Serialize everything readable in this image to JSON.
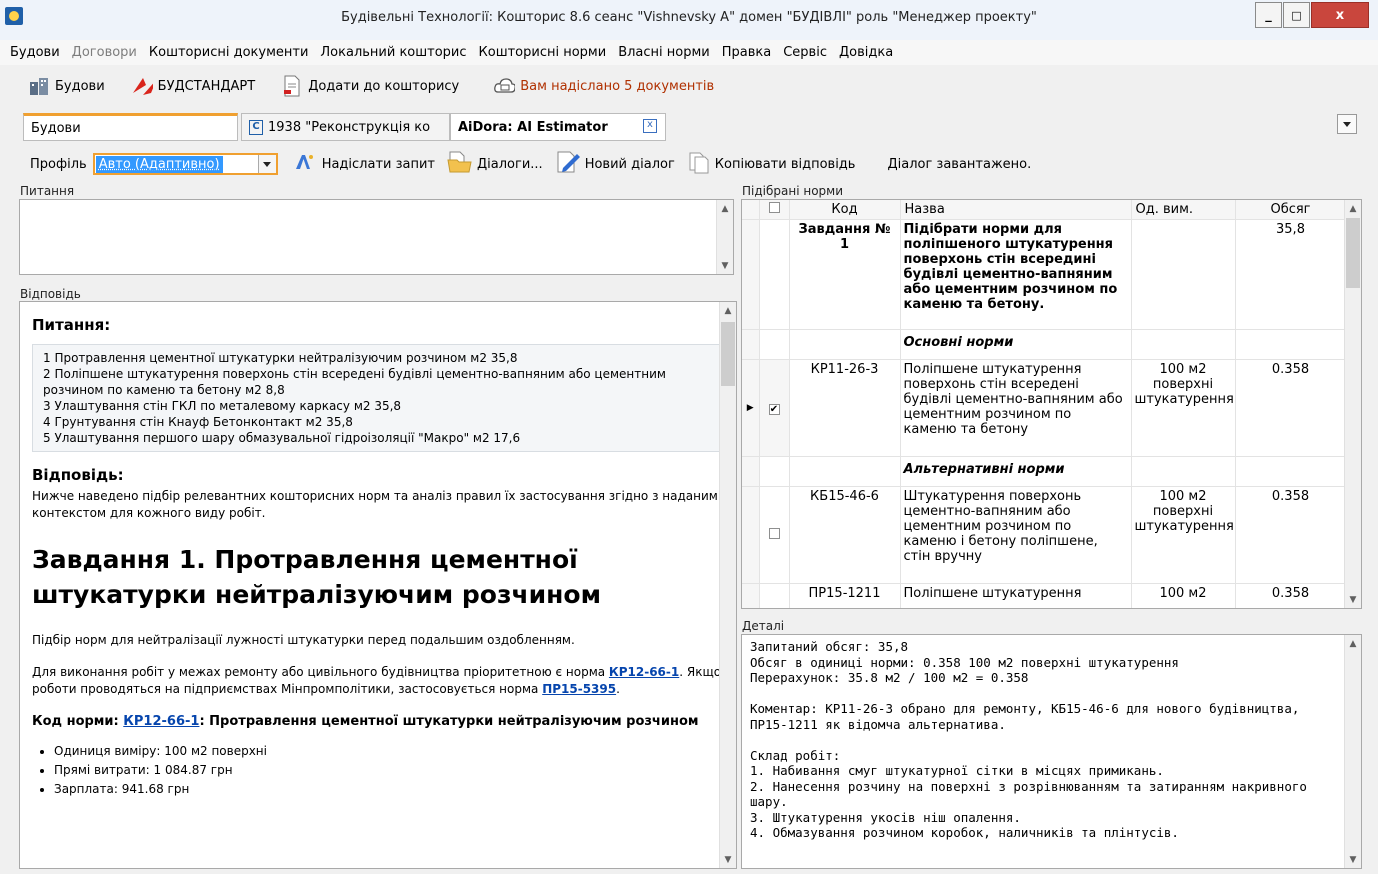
{
  "window": {
    "title": "Будівельні Технології: Кошторис 8.6     сеанс \"Vishnevsky A\"  домен \"БУДІВЛІ\" роль \"Менеджер проекту\"",
    "minimize": "_",
    "maximize": "□",
    "close": "x"
  },
  "menu": [
    "Будови",
    "Договори",
    "Кошторисні документи",
    "Локальний кошторис",
    "Кошторисні норми",
    "Власні норми",
    "Правка",
    "Сервіс",
    "Довідка"
  ],
  "toolbar": {
    "buildings": "Будови",
    "budstandart": "БУДСТАНДАРТ",
    "add_to_estimate": "Додати до кошторису",
    "sent_docs": "Вам надіслано 5 документів"
  },
  "tabs": {
    "t1": "Будови",
    "t2": "1938 \"Реконструкція ко",
    "t2_icon": "C",
    "t3": "AiDora: AI Estimator",
    "close": "x"
  },
  "profile": {
    "label": "Профіль",
    "value": "Авто (Адаптивно)",
    "send": "Надіслати запит",
    "dialogs": "Діалоги...",
    "new_dialog": "Новий діалог",
    "copy": "Копіювати відповідь",
    "status": "Діалог завантажено."
  },
  "question_label": "Питання",
  "answer_label": "Відповідь",
  "answer": {
    "q_heading": "Питання:",
    "questions": [
      "1 Протравлення цементної штукатурки нейтралізуючим розчином м2 35,8",
      "2 Поліпшене штукатурення поверхонь стін всередені будівлі цементно-вапняним або цементним розчином по каменю та бетону м2 8,8",
      "3 Улаштування стін ГКЛ по металевому каркасу м2 35,8",
      "4 Грунтування стін Кнауф Бетонконтакт м2 35,8",
      "5 Улаштування першого шару обмазувальної гідроізоляції \"Макро\" м2 17,6"
    ],
    "a_heading": "Відповідь:",
    "intro": "Нижче наведено підбір релевантних кошторисних норм та аналіз правил їх застосування згідно з наданим контекстом для кожного виду робіт.",
    "task_title": "Завдання 1. Протравлення цементної штукатурки нейтралізуючим розчином",
    "p1": "Підбір норм для нейтралізації лужності штукатурки перед подальшим оздобленням.",
    "p2a": "Для виконання робіт у межах ремонту або цивільного будівництва пріоритетною є норма ",
    "p2_link1": "КР12-66-1",
    "p2b": ". Якщо роботи проводяться на підприємствах Мінпромполітики, застосовується норма ",
    "p2_link2": "ПР15-5395",
    "p2c": ".",
    "code_label": "Код норми: ",
    "code_link": "КР12-66-1",
    "code_rest": ": Протравлення цементної штукатурки нейтралізуючим розчином",
    "bullets": [
      "Одиниця виміру: 100 м2 поверхні",
      "Прямі витрати: 1 084.87 грн",
      "Зарплата: 941.68 грн"
    ]
  },
  "norms_label": "Підібрані норми",
  "norms": {
    "headers": {
      "code": "Код",
      "name": "Назва",
      "unit": "Од. вим.",
      "volume": "Обсяг"
    },
    "task_code": "Завдання № 1",
    "task_name": "Підібрати норми для поліпшеного штукатурення поверхонь стін всередині будівлі цементно-вапняним або цементним розчином по каменю та бетону.",
    "task_volume": "35,8",
    "main_group": "Основні норми",
    "alt_group": "Альтернативні норми",
    "rows": [
      {
        "code": "КР11-26-3",
        "name": "Поліпшене штукатурення поверхонь стін всередені будівлі цементно-вапняним або цементним розчином по каменю та бетону",
        "unit": "100 м2 поверхні штукатурення",
        "volume": "0.358",
        "checked": "✔"
      },
      {
        "code": "КБ15-46-6",
        "name": "Штукатурення поверхонь цементно-вапняним або цементним розчином по каменю і бетону поліпшене, стін вручну",
        "unit": "100 м2 поверхні штукатурення",
        "volume": "0.358",
        "checked": ""
      },
      {
        "code": "ПР15-1211",
        "name": "Поліпшене штукатурення",
        "unit": "100 м2",
        "volume": "0.358",
        "checked": ""
      }
    ]
  },
  "details_label": "Деталі",
  "details": [
    "Запитаний обсяг: 35,8",
    "Обсяг в одиниці норми: 0.358 100 м2 поверхні штукатурення",
    "Перерахунок: 35.8 м2 / 100 м2 = 0.358",
    "",
    "Коментар: КР11-26-3 обрано для ремонту, КБ15-46-6 для нового будівництва, ПР15-1211 як відомча альтернатива.",
    "",
    "Склад робіт:",
    "1. Набивання смуг штукатурної сітки в місцях примикань.",
    "2. Нанесення розчину на поверхні з розрівнюванням та затиранням накривного шару.",
    "3. Штукатурення укосів ніш опалення.",
    "4. Обмазування розчином коробок, наличників та плінтусів."
  ],
  "colors": {
    "accent": "#3399ff",
    "orange": "#f0a030",
    "tab_border": "#e08a00",
    "link": "#0645ad",
    "warn_text": "#b03000"
  }
}
